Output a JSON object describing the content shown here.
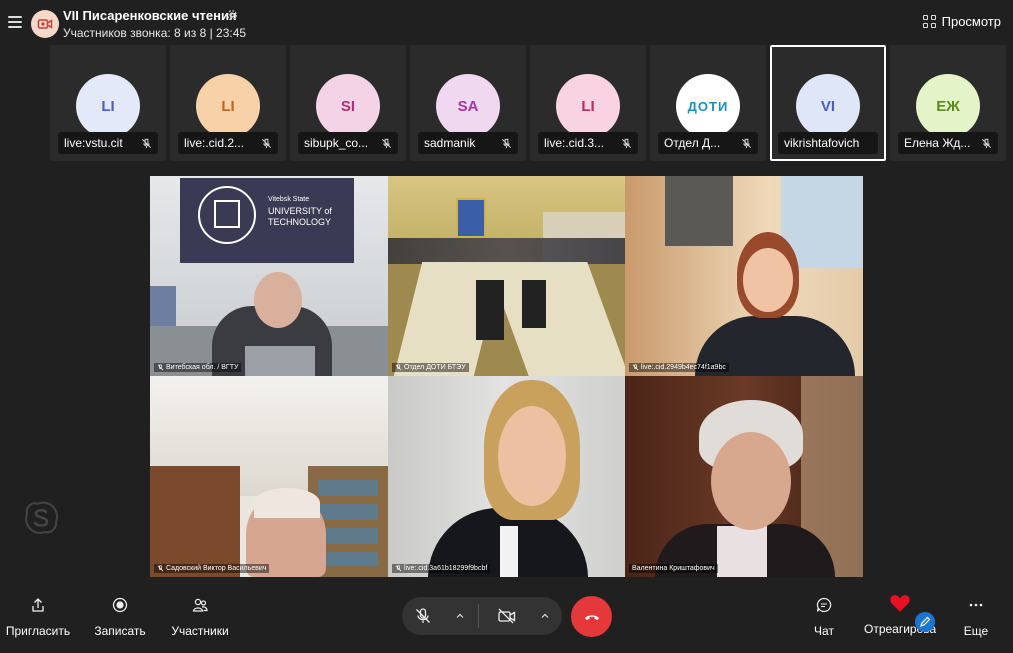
{
  "header": {
    "title": "VII Писаренковские чтения",
    "subtitle": "Участников звонка: 8 из 8 | 23:45",
    "view_label": "Просмотр"
  },
  "participants": [
    {
      "initials": "LI",
      "name": "live:vstu.cit",
      "avatar_bg": "#e3e9f8",
      "initials_color": "#4a5fc1",
      "muted": true
    },
    {
      "initials": "LI",
      "name": "live:.cid.2...",
      "avatar_bg": "#f7d2a8",
      "initials_color": "#c4621a",
      "muted": true
    },
    {
      "initials": "SI",
      "name": "sibupk_co...",
      "avatar_bg": "#f5d3e6",
      "initials_color": "#b32d7a",
      "muted": true
    },
    {
      "initials": "SA",
      "name": "sadmanik",
      "avatar_bg": "#f1d8f1",
      "initials_color": "#a436a4",
      "muted": true
    },
    {
      "initials": "LI",
      "name": "live:.cid.3...",
      "avatar_bg": "#f9d3e1",
      "initials_color": "#c2275c",
      "muted": true
    },
    {
      "initials": "",
      "name": "Отдел Д...",
      "avatar_bg": "#ffffff",
      "initials_color": "#1a8fc7",
      "muted": true,
      "logo": "ДОТИ"
    },
    {
      "initials": "VI",
      "name": "vikrishtafovich",
      "avatar_bg": "#dfe6f8",
      "initials_color": "#4a5fc1",
      "muted": false,
      "active": true
    },
    {
      "initials": "ЕЖ",
      "name": "Елена Жд...",
      "avatar_bg": "#e4f3c8",
      "initials_color": "#5c8a1c",
      "muted": true
    }
  ],
  "videos": [
    {
      "label": "Витебская обл. / ВГТУ",
      "sign_l1": "Vitebsk State",
      "sign_l2": "UNIVERSITY of",
      "sign_l3": "TECHNOLOGY"
    },
    {
      "label": "Отдел ДОТИ БТЭУ"
    },
    {
      "label": "live:.cid.2949b4ec74f1a9bc"
    },
    {
      "label": "Садовский Виктор Васильевич"
    },
    {
      "label": "live:.cid.3a61b18299f9bcbf"
    },
    {
      "label": "Валентина Криштафович"
    }
  ],
  "toolbar": {
    "invite": "Пригласить",
    "record": "Записать",
    "participants": "Участники",
    "chat": "Чат",
    "react": "Отреагировать",
    "more": "Еще"
  },
  "colors": {
    "background": "#202020",
    "tile": "#2b2b2b",
    "hangup": "#e5383b",
    "heart": "#e81123",
    "pen_badge": "#1976d2"
  },
  "icons": [
    "menu-icon",
    "call-avatar-icon",
    "gear-icon",
    "grid-icon",
    "mic-off-icon",
    "share-icon",
    "record-icon",
    "people-icon",
    "camera-off-icon",
    "chevron-up-icon",
    "hang-up-icon",
    "chat-icon",
    "heart-icon",
    "pen-icon",
    "more-icon",
    "skype-logo"
  ]
}
